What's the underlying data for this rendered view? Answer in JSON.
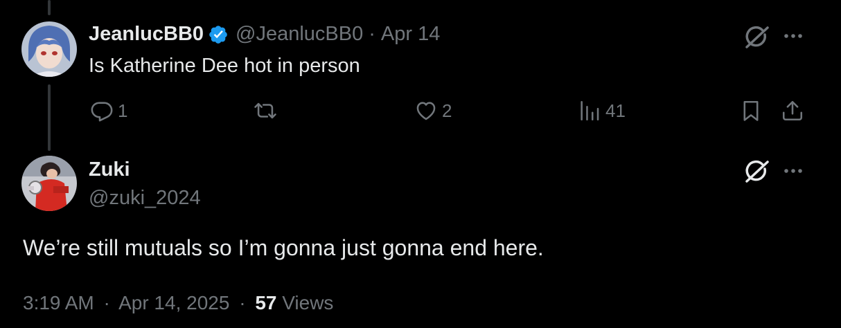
{
  "reply": {
    "display_name": "JeanlucBB0",
    "handle": "@JeanlucBB0",
    "separator": "·",
    "date": "Apr 14",
    "text": "Is Katherine Dee hot in person",
    "replies": "1",
    "likes": "2",
    "views": "41"
  },
  "main": {
    "display_name": "Zuki",
    "handle": "@zuki_2024",
    "text": "We’re still mutuals so I’m gonna just gonna end here.",
    "time": "3:19 AM",
    "sep1": "·",
    "date": "Apr 14, 2025",
    "sep2": "·",
    "views_count": "57",
    "views_label": "Views"
  },
  "colors": {
    "background": "#000000",
    "text": "#e7e9ea",
    "muted": "#71767b",
    "verified": "#1d9bf0",
    "thread_line": "#333639"
  },
  "icons": [
    "grok-icon",
    "more-icon",
    "reply-icon",
    "retweet-icon",
    "like-icon",
    "views-icon",
    "bookmark-icon",
    "share-icon",
    "verified-badge-icon"
  ]
}
